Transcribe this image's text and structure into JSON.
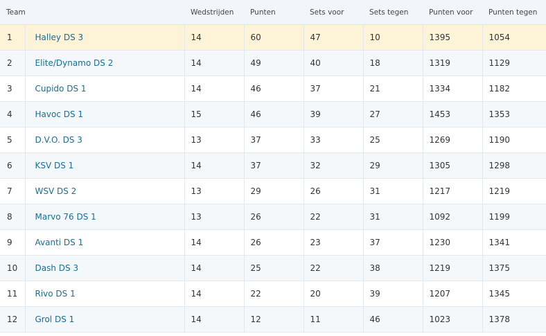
{
  "table": {
    "headers": [
      "Team",
      "Wedstrijden",
      "Punten",
      "Sets voor",
      "Sets tegen",
      "Punten voor",
      "Punten tegen"
    ],
    "rows": [
      {
        "pos": "1",
        "team": "Halley DS 3",
        "wedstrijden": "14",
        "punten": "60",
        "sets_voor": "47",
        "sets_tegen": "10",
        "punten_voor": "1395",
        "punten_tegen": "1054",
        "highlighted": true
      },
      {
        "pos": "2",
        "team": "Elite/Dynamo DS 2",
        "wedstrijden": "14",
        "punten": "49",
        "sets_voor": "40",
        "sets_tegen": "18",
        "punten_voor": "1319",
        "punten_tegen": "1129"
      },
      {
        "pos": "3",
        "team": "Cupido DS 1",
        "wedstrijden": "14",
        "punten": "46",
        "sets_voor": "37",
        "sets_tegen": "21",
        "punten_voor": "1334",
        "punten_tegen": "1182"
      },
      {
        "pos": "4",
        "team": "Havoc DS 1",
        "wedstrijden": "15",
        "punten": "46",
        "sets_voor": "39",
        "sets_tegen": "27",
        "punten_voor": "1453",
        "punten_tegen": "1353"
      },
      {
        "pos": "5",
        "team": "D.V.O. DS 3",
        "wedstrijden": "13",
        "punten": "37",
        "sets_voor": "33",
        "sets_tegen": "25",
        "punten_voor": "1269",
        "punten_tegen": "1190"
      },
      {
        "pos": "6",
        "team": "KSV DS 1",
        "wedstrijden": "14",
        "punten": "37",
        "sets_voor": "32",
        "sets_tegen": "29",
        "punten_voor": "1305",
        "punten_tegen": "1298"
      },
      {
        "pos": "7",
        "team": "WSV DS 2",
        "wedstrijden": "13",
        "punten": "29",
        "sets_voor": "26",
        "sets_tegen": "31",
        "punten_voor": "1217",
        "punten_tegen": "1219"
      },
      {
        "pos": "8",
        "team": "Marvo 76 DS 1",
        "wedstrijden": "13",
        "punten": "26",
        "sets_voor": "22",
        "sets_tegen": "31",
        "punten_voor": "1092",
        "punten_tegen": "1199"
      },
      {
        "pos": "9",
        "team": "Avanti DS 1",
        "wedstrijden": "14",
        "punten": "26",
        "sets_voor": "23",
        "sets_tegen": "37",
        "punten_voor": "1230",
        "punten_tegen": "1341"
      },
      {
        "pos": "10",
        "team": "Dash DS 3",
        "wedstrijden": "14",
        "punten": "25",
        "sets_voor": "22",
        "sets_tegen": "38",
        "punten_voor": "1219",
        "punten_tegen": "1375"
      },
      {
        "pos": "11",
        "team": "Rivo DS 1",
        "wedstrijden": "14",
        "punten": "22",
        "sets_voor": "20",
        "sets_tegen": "39",
        "punten_voor": "1207",
        "punten_tegen": "1345"
      },
      {
        "pos": "12",
        "team": "Grol DS 1",
        "wedstrijden": "14",
        "punten": "12",
        "sets_voor": "11",
        "sets_tegen": "46",
        "punten_voor": "1023",
        "punten_tegen": "1378"
      }
    ]
  },
  "colors": {
    "header_bg": "#f2f6fa",
    "row_alt_bg": "#f4f8fb",
    "highlight_bg": "#fdf4d8",
    "link": "#1a6d93",
    "border": "#e3e8ec"
  }
}
